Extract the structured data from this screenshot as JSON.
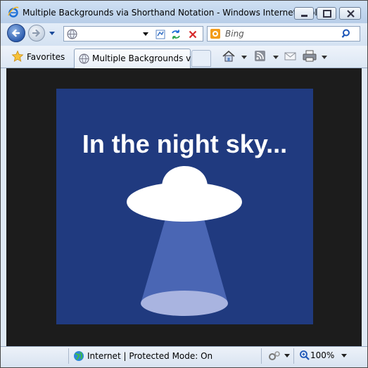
{
  "window": {
    "title": "Multiple Backgrounds via Shorthand Notation - Windows Internet Expl..."
  },
  "navigation": {
    "address_value": "",
    "search_placeholder": "Bing"
  },
  "favorites_bar": {
    "favorites_label": "Favorites",
    "active_tab_label": "Multiple Backgrounds vi..."
  },
  "page": {
    "heading": "In the night sky...",
    "colors": {
      "page_background": "#1c1c1c",
      "sky": "#203a7f",
      "ufo": "#ffffff",
      "beam": "#4a66b4",
      "beam_spot": "#a9b4e0"
    }
  },
  "status_bar": {
    "zone_text": "Internet | Protected Mode: On",
    "zoom": "100%"
  },
  "icons": {
    "app": "ie-logo-icon",
    "back": "back-arrow-icon",
    "forward": "forward-arrow-icon",
    "compat": "compatibility-view-icon",
    "refresh": "refresh-icon",
    "stop": "stop-icon",
    "search": "search-icon",
    "home": "home-icon",
    "feeds": "rss-feed-icon",
    "mail": "mail-icon",
    "print": "print-icon",
    "globe": "globe-icon",
    "settings": "security-settings-icon",
    "zoom": "zoom-icon"
  }
}
